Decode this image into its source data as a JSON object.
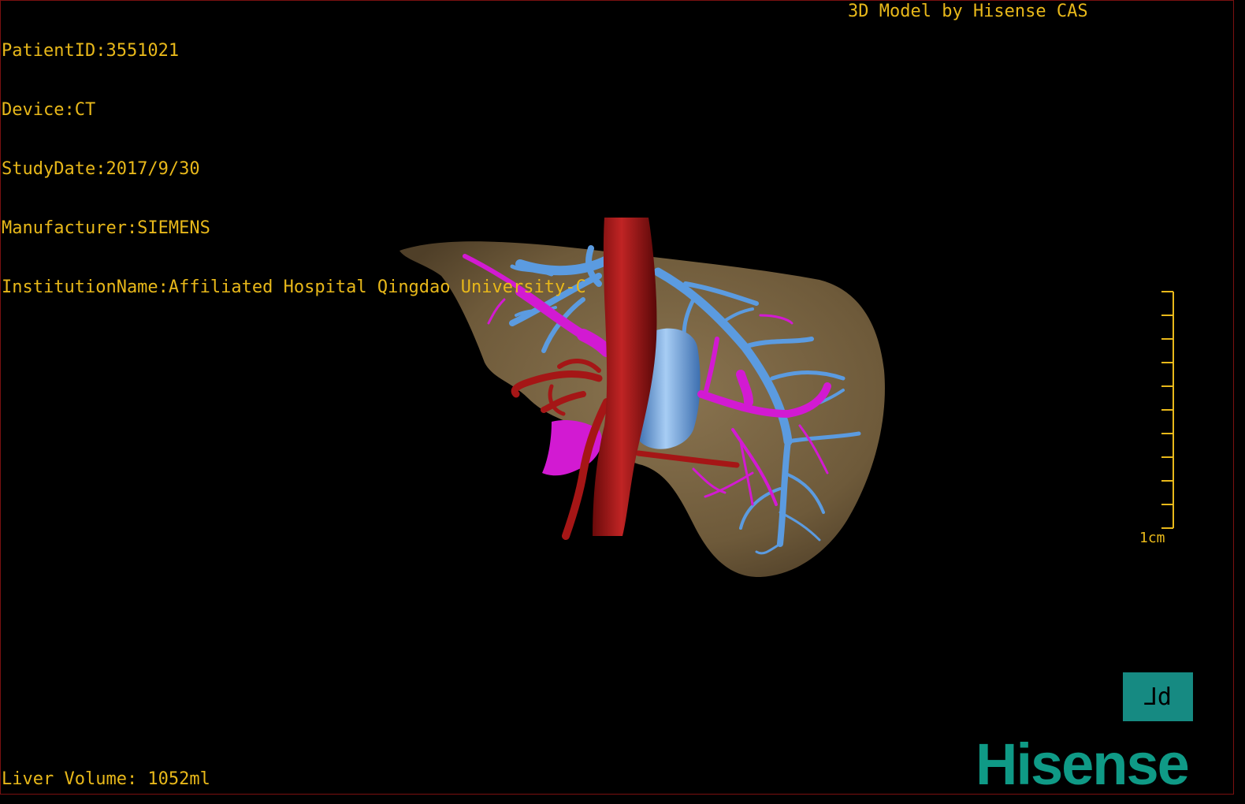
{
  "overlay": {
    "patient_id": "PatientID:3551021",
    "device": "Device:CT",
    "study_date": "StudyDate:2017/9/30",
    "manufacturer": "Manufacturer:SIEMENS",
    "institution": "InstitutionName:Affiliated Hospital Qingdao University-C",
    "credit": "3D Model by Hisense CAS",
    "liver_volume": "Liver Volume: 1052ml",
    "scale_label": "1cm"
  },
  "view_button": {
    "label": "⅃d"
  },
  "logo": {
    "text": "Hisense"
  },
  "colors": {
    "overlay_text": "#e8b81a",
    "liver": "#6e5a3a",
    "artery": "#a51616",
    "portal_vein": "#d21ad2",
    "hepatic_vein": "#5b9be0",
    "logo": "#0f9a86",
    "view_button": "#168a82"
  }
}
